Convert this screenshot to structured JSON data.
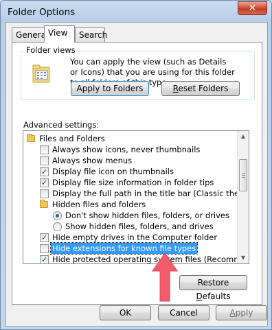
{
  "window": {
    "title": "Folder Options",
    "close_glyph": "✕"
  },
  "tabs": [
    {
      "label": "General"
    },
    {
      "label": "View"
    },
    {
      "label": "Search"
    }
  ],
  "folder_views": {
    "group_label": "Folder views",
    "description": "You can apply the view (such as Details or Icons) that you are using for this folder to all folders of this type.",
    "apply_to_folders_label": "Apply to Folders",
    "reset_folders_label_u": "R",
    "reset_folders_label_rest": "eset Folders",
    "icon": "folder-views-icon"
  },
  "advanced": {
    "label": "Advanced settings:",
    "items": [
      {
        "type": "folder",
        "label": "Files and Folders"
      },
      {
        "type": "checkbox",
        "checked": false,
        "label": "Always show icons, never thumbnails"
      },
      {
        "type": "checkbox",
        "checked": false,
        "label": "Always show menus"
      },
      {
        "type": "checkbox",
        "checked": true,
        "label": "Display file icon on thumbnails"
      },
      {
        "type": "checkbox",
        "checked": true,
        "label": "Display file size information in folder tips"
      },
      {
        "type": "checkbox",
        "checked": false,
        "label": "Display the full path in the title bar (Classic theme only)"
      },
      {
        "type": "folder",
        "label": "Hidden files and folders"
      },
      {
        "type": "radio",
        "checked": true,
        "label": "Don't show hidden files, folders, or drives"
      },
      {
        "type": "radio",
        "checked": false,
        "label": "Show hidden files, folders, and drives"
      },
      {
        "type": "checkbox",
        "checked": true,
        "label": "Hide empty drives in the Computer folder"
      },
      {
        "type": "checkbox",
        "checked": false,
        "label": "Hide extensions for known file types",
        "selected": true
      },
      {
        "type": "checkbox",
        "checked": true,
        "label": "Hide protected operating system files (Recommended)"
      }
    ],
    "check_glyph": "✓"
  },
  "restore_defaults_label_u": "D",
  "restore_defaults_label_pre": "Restore ",
  "restore_defaults_label_post": "efaults",
  "footer": {
    "ok_label": "OK",
    "cancel_label": "Cancel",
    "apply_label_u": "A",
    "apply_label_rest": "pply"
  },
  "colors": {
    "selection": "#3399ff",
    "annotation_arrow": "#f25d6e"
  }
}
